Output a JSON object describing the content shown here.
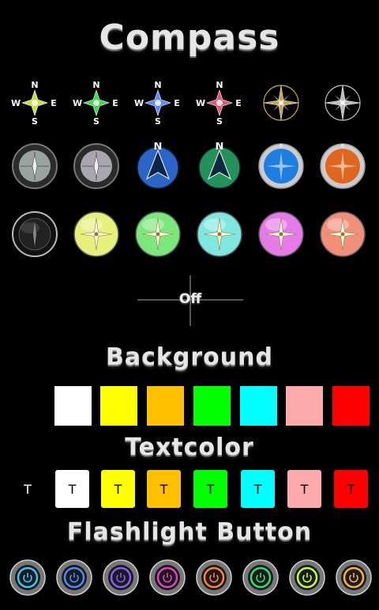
{
  "app_title": "Compass",
  "compass_rows": [
    [
      {
        "name": "compass-star-yellow-icon",
        "style": "star",
        "color": "#c8e03a"
      },
      {
        "name": "compass-star-green-icon",
        "style": "star",
        "color": "#3adb52"
      },
      {
        "name": "compass-star-blue-icon",
        "style": "star",
        "color": "#5a8cff"
      },
      {
        "name": "compass-star-pink-icon",
        "style": "star",
        "color": "#e0567a"
      },
      {
        "name": "compass-rose-gold-icon",
        "style": "rose",
        "color": "#c9a34a"
      },
      {
        "name": "compass-rose-silver-icon",
        "style": "rose",
        "color": "#bbbbbb"
      }
    ],
    [
      {
        "name": "compass-dial-dark-icon",
        "style": "dial",
        "color": "#9aa3a0"
      },
      {
        "name": "compass-dial-light-icon",
        "style": "dial",
        "color": "#a9a6b0"
      },
      {
        "name": "compass-arrow-blue-icon",
        "style": "arrow",
        "color": "#2a64c8"
      },
      {
        "name": "compass-arrow-green-icon",
        "style": "arrow",
        "color": "#23915a"
      },
      {
        "name": "compass-bezel-blue-icon",
        "style": "bezel",
        "color": "#1e7fe0"
      },
      {
        "name": "compass-bezel-orange-icon",
        "style": "bezel",
        "color": "#e0651e"
      }
    ],
    [
      {
        "name": "compass-black-icon",
        "style": "black",
        "color": "#1a1a1a"
      },
      {
        "name": "compass-sphere-yellow-icon",
        "style": "sphere",
        "color": "#e6f07a"
      },
      {
        "name": "compass-sphere-green-icon",
        "style": "sphere",
        "color": "#7ae87a"
      },
      {
        "name": "compass-sphere-cyan-icon",
        "style": "sphere",
        "color": "#7ee8e0"
      },
      {
        "name": "compass-sphere-magenta-icon",
        "style": "sphere",
        "color": "#e57ae8"
      },
      {
        "name": "compass-sphere-salmon-icon",
        "style": "sphere",
        "color": "#f0907a"
      }
    ]
  ],
  "off_toggle": {
    "label": "Off"
  },
  "background": {
    "title": "Background",
    "colors": [
      "#ffffff",
      "#ffff00",
      "#ffc000",
      "#00ff00",
      "#00ffff",
      "#ffaaaa",
      "#ff0000"
    ]
  },
  "textcolor": {
    "title": "Textcolor",
    "plain_label": "T",
    "swatches": [
      {
        "label": "T",
        "color": "#ffffff"
      },
      {
        "label": "T",
        "color": "#ffff00"
      },
      {
        "label": "T",
        "color": "#ffc000"
      },
      {
        "label": "T",
        "color": "#00ff00"
      },
      {
        "label": "T",
        "color": "#00ffff"
      },
      {
        "label": "T",
        "color": "#ffaaaa"
      },
      {
        "label": "T",
        "color": "#ff0000"
      }
    ]
  },
  "flashlight": {
    "title": "Flashlight Button",
    "buttons": [
      {
        "name": "flashlight-button-cyan",
        "color": "#39c6ff"
      },
      {
        "name": "flashlight-button-blue",
        "color": "#4b8bff"
      },
      {
        "name": "flashlight-button-violet",
        "color": "#8a5cff"
      },
      {
        "name": "flashlight-button-magenta",
        "color": "#e040c8"
      },
      {
        "name": "flashlight-button-orange",
        "color": "#ff8040"
      },
      {
        "name": "flashlight-button-green",
        "color": "#30e070"
      },
      {
        "name": "flashlight-button-lime",
        "color": "#c0ff40"
      },
      {
        "name": "flashlight-button-amber",
        "color": "#ffb040"
      }
    ]
  }
}
